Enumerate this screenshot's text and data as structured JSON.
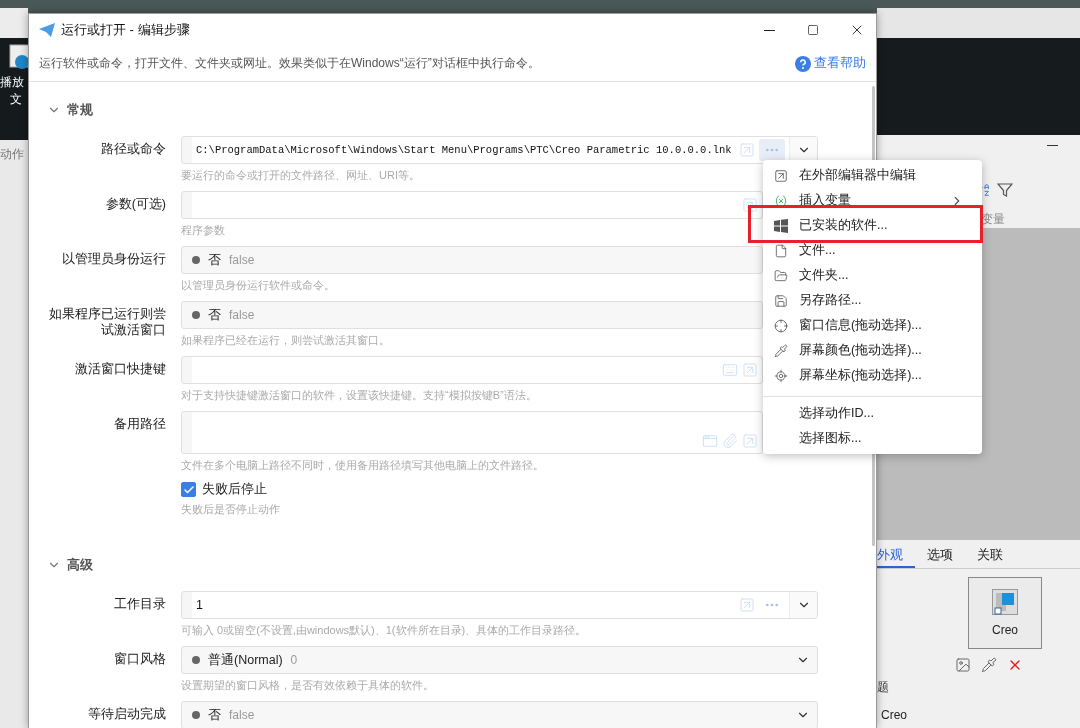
{
  "left_window": {
    "captions": [
      "播放",
      "文"
    ],
    "label": "动作"
  },
  "right_window": {
    "column_header": "变量",
    "tabs": [
      {
        "label": "外观",
        "selected": true
      },
      {
        "label": "选项",
        "selected": false
      },
      {
        "label": "关联",
        "selected": false
      }
    ],
    "icon_caption": "Creo",
    "field_label": "题",
    "field_value": "Creo"
  },
  "dialog": {
    "title": "运行或打开 - 编辑步骤",
    "description": "运行软件或命令，打开文件、文件夹或网址。效果类似于在Windows“运行”对话框中执行命令。",
    "help": "查看帮助",
    "sections": [
      {
        "title": "常规",
        "expanded": true,
        "rows": [
          {
            "kind": "path",
            "label": "路径或命令",
            "value": "C:\\ProgramData\\Microsoft\\Windows\\Start Menu\\Programs\\PTC\\Creo Parametric 10.0.0.0.lnk",
            "dropdown": true,
            "hint": "要运行的命令或打开的文件路径、网址、URI等。"
          },
          {
            "kind": "text",
            "label": "参数(可选)",
            "dropdown": false,
            "hint": "程序参数"
          },
          {
            "kind": "toggle",
            "label": "以管理员身份运行",
            "option": "否",
            "code": "false",
            "hint": "以管理员身份运行软件或命令。"
          },
          {
            "kind": "toggle",
            "label": "如果程序已运行则尝试激活窗口",
            "option": "否",
            "code": "false",
            "hint": "如果程序已经在运行，则尝试激活其窗口。"
          },
          {
            "kind": "hotkey",
            "label": "激活窗口快捷键",
            "hint": "对于支持快捷键激活窗口的软件，设置该快捷键。支持“模拟按键B”语法。"
          },
          {
            "kind": "area",
            "label": "备用路径",
            "hint": "文件在多个电脑上路径不同时，使用备用路径填写其他电脑上的文件路径。"
          },
          {
            "kind": "checkbox",
            "label": "失败后停止",
            "checked": true,
            "hint": "失败后是否停止动作"
          }
        ]
      },
      {
        "title": "高级",
        "expanded": true,
        "rows": [
          {
            "kind": "text",
            "label": "工作目录",
            "value": "1",
            "dropdown": true,
            "hint": "可输入 0或留空(不设置,由windows默认)、1(软件所在目录)、具体的工作目录路径。"
          },
          {
            "kind": "select",
            "label": "窗口风格",
            "option": "普通(Normal)",
            "code": "0",
            "hint": "设置期望的窗口风格，是否有效依赖于具体的软件。"
          },
          {
            "kind": "select",
            "label": "等待启动完成",
            "option": "否",
            "code": "false"
          }
        ]
      }
    ]
  },
  "menu": {
    "groups": [
      {
        "items": [
          {
            "kind": "edit",
            "label": "在外部编辑器中编辑",
            "submenu": false,
            "highlighted": false
          },
          {
            "kind": "variable",
            "label": "插入变量",
            "submenu": true,
            "highlighted": false
          },
          {
            "kind": "windows",
            "label": "已安装的软件...",
            "submenu": false,
            "highlighted": true
          },
          {
            "kind": "file",
            "label": "文件...",
            "submenu": false,
            "highlighted": false
          },
          {
            "kind": "folder",
            "label": "文件夹...",
            "submenu": false,
            "highlighted": false
          },
          {
            "kind": "save",
            "label": "另存路径...",
            "submenu": false,
            "highlighted": false
          },
          {
            "kind": "crosshair",
            "label": "窗口信息(拖动选择)...",
            "submenu": false,
            "highlighted": false
          },
          {
            "kind": "picker",
            "label": "屏幕颜色(拖动选择)...",
            "submenu": false,
            "highlighted": false
          },
          {
            "kind": "target",
            "label": "屏幕坐标(拖动选择)...",
            "submenu": false,
            "highlighted": false
          }
        ]
      },
      {
        "items": [
          {
            "kind": "plain",
            "label": "选择动作ID...",
            "submenu": false,
            "highlighted": false
          },
          {
            "kind": "plain",
            "label": "选择图标...",
            "submenu": false,
            "highlighted": false
          }
        ]
      }
    ]
  }
}
